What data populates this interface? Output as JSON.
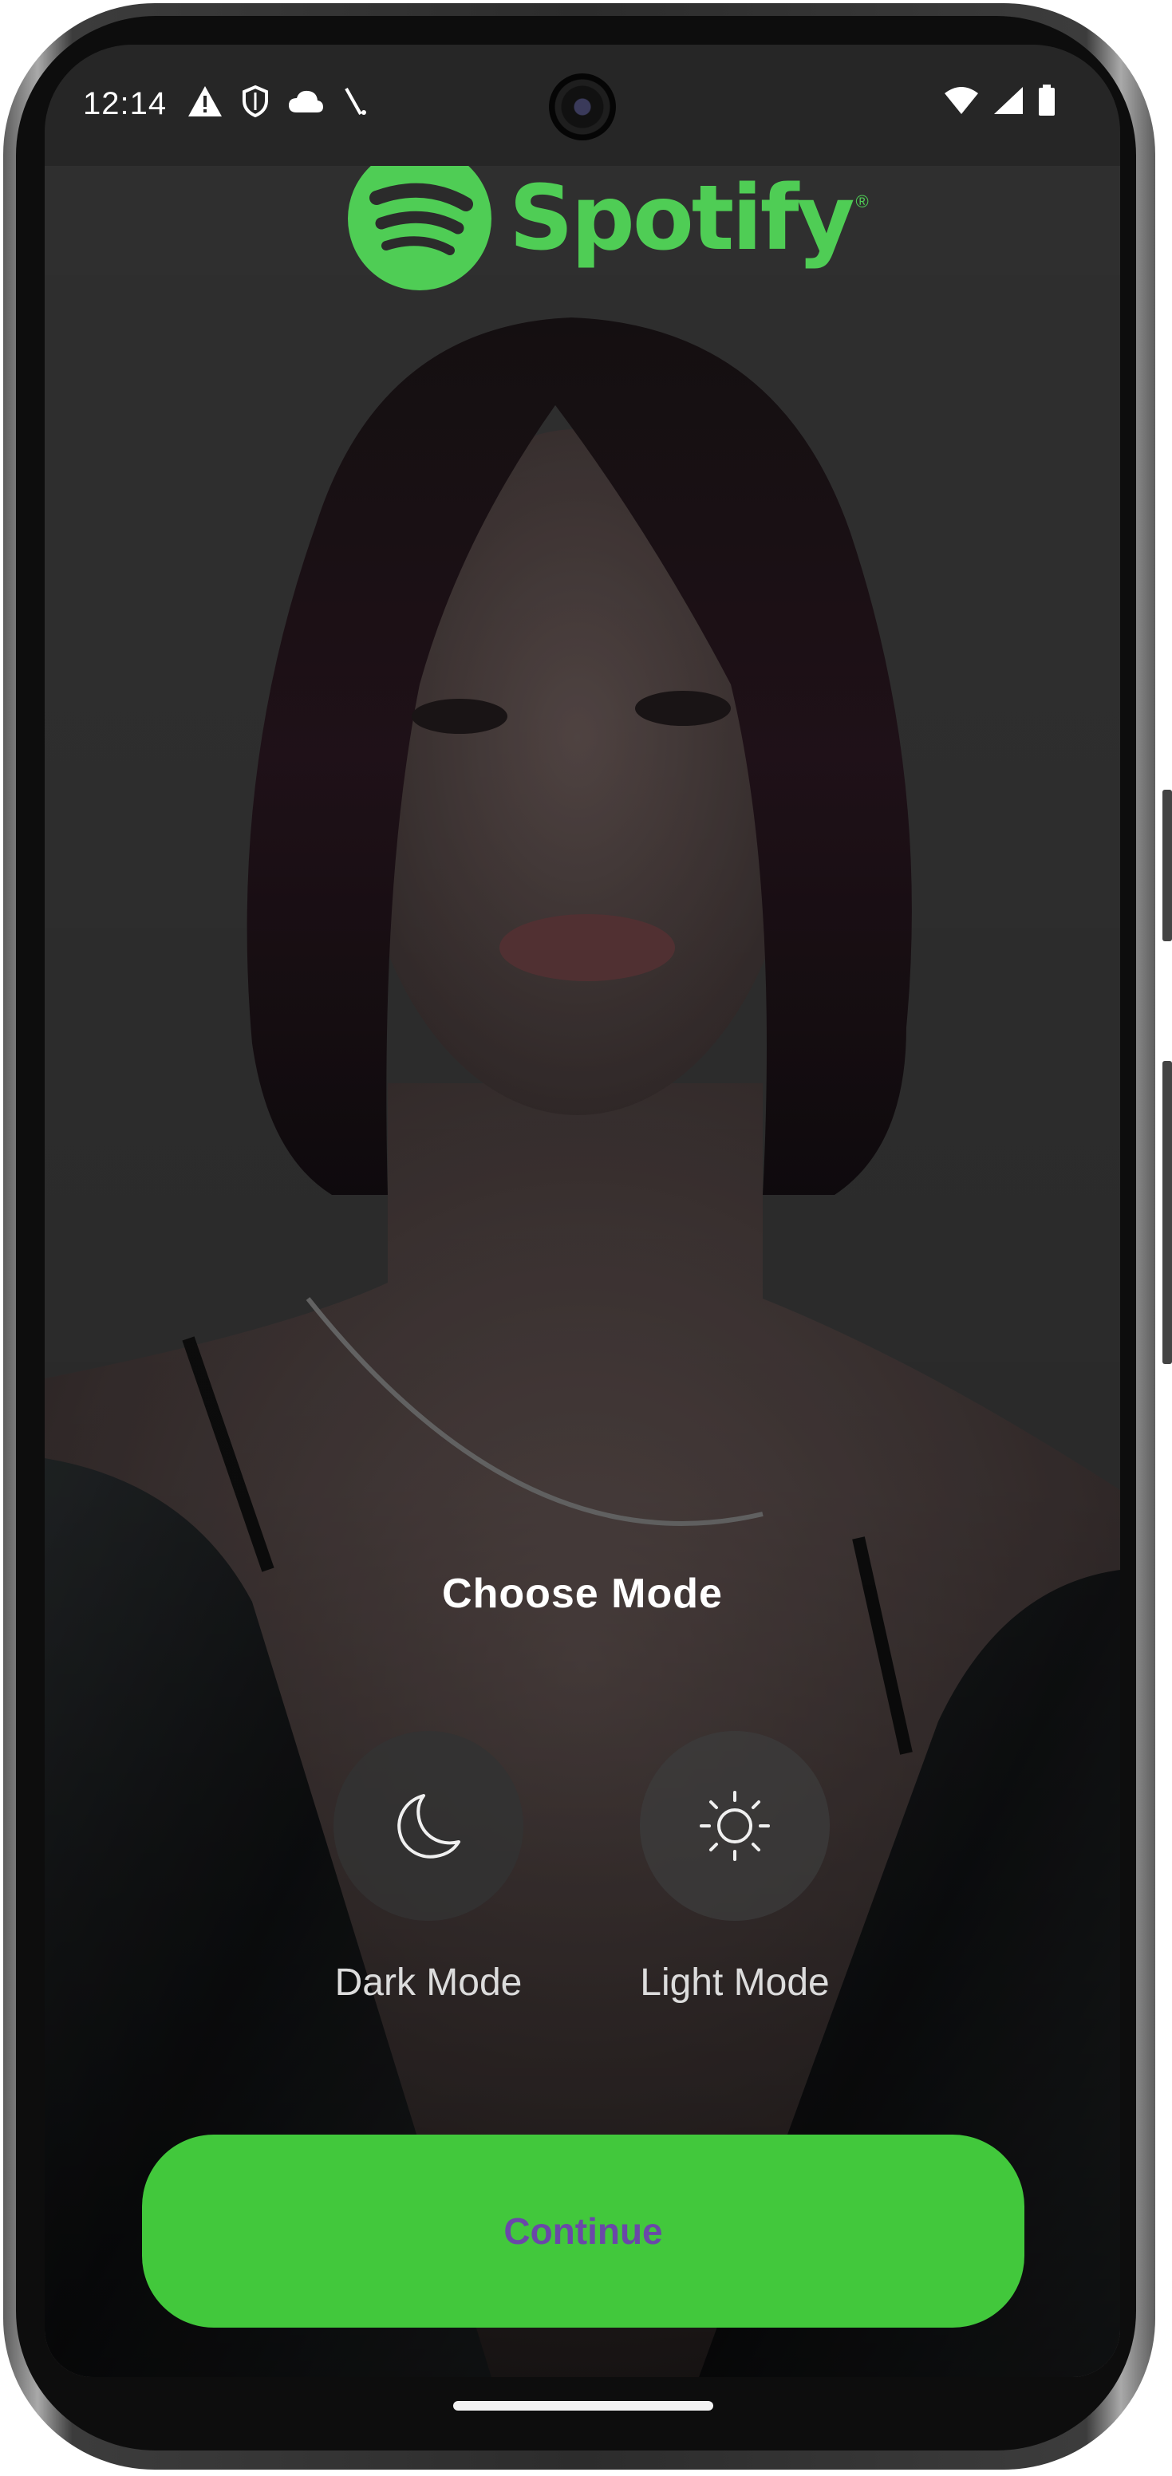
{
  "status_bar": {
    "time": "12:14",
    "left_icons": [
      "warning-icon",
      "shield-icon",
      "cloud-icon",
      "signal-slash-icon"
    ],
    "right_icons": [
      "wifi-icon",
      "cellular-icon",
      "battery-icon"
    ]
  },
  "brand": {
    "name": "Spotify",
    "registered_mark": "®",
    "color": "#4fcd55"
  },
  "mode_picker": {
    "title": "Choose Mode",
    "options": [
      {
        "label": "Dark Mode",
        "icon": "moon-icon"
      },
      {
        "label": "Light Mode",
        "icon": "sun-icon"
      }
    ]
  },
  "actions": {
    "continue_label": "Continue",
    "continue_color": "#42c83c",
    "continue_text_color": "#6a48a8"
  }
}
